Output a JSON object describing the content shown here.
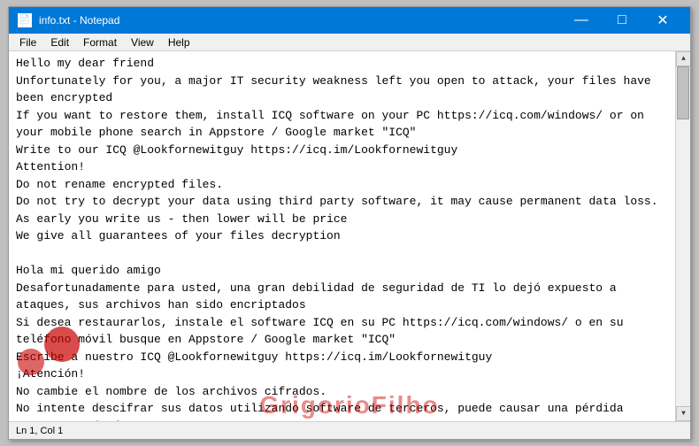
{
  "window": {
    "title": "info.txt - Notepad",
    "icon": "📄"
  },
  "titlebar": {
    "minimize_label": "—",
    "maximize_label": "□",
    "close_label": "✕"
  },
  "menu": {
    "items": [
      "File",
      "Edit",
      "Format",
      "View",
      "Help"
    ]
  },
  "content": {
    "text": "Hello my dear friend\nUnfortunately for you, a major IT security weakness left you open to attack, your files have been encrypted\nIf you want to restore them, install ICQ software on your PC https://icq.com/windows/ or on your mobile phone search in Appstore / Google market \"ICQ\"\nWrite to our ICQ @Lookfornewitguy https://icq.im/Lookfornewitguy\nAttention!\nDo not rename encrypted files.\nDo not try to decrypt your data using third party software, it may cause permanent data loss.\nAs early you write us - then lower will be price\nWe give all guarantees of your files decryption\n\nHola mi querido amigo\nDesafortunadamente para usted, una gran debilidad de seguridad de TI lo dejó expuesto a ataques, sus archivos han sido encriptados\nSi desea restaurarlos, instale el software ICQ en su PC https://icq.com/windows/ o en su teléfono móvil busque en Appstore / Google market \"ICQ\"\nEscribe a nuestro ICQ @Lookfornewitguy https://icq.im/Lookfornewitguy\n¡Atención!\nNo cambie el nombre de los archivos cifrados.\nNo intente descifrar sus datos utilizando software de terceros, puede causar una pérdida permanente de datos.\nTan pronto como nos escriba, el precio será más bajo\nDamos todas las garantías de descifrado de sus archivos"
  },
  "statusbar": {
    "text": "Ln 1, Col 1"
  },
  "watermark": {
    "text": "GrigorioFilho"
  }
}
